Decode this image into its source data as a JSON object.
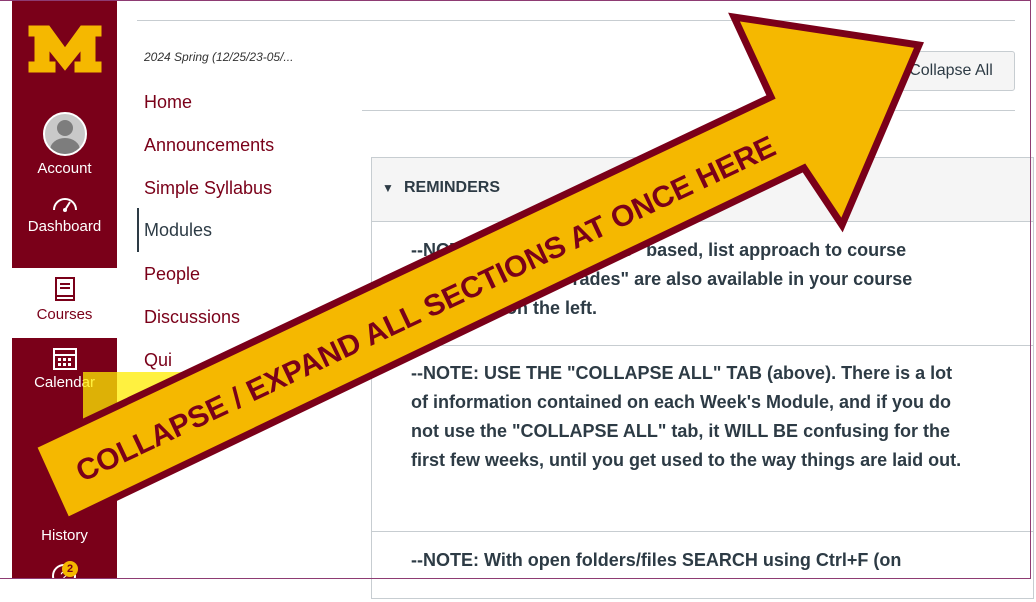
{
  "global_nav": {
    "account": "Account",
    "dashboard": "Dashboard",
    "courses": "Courses",
    "calendar": "Calendar",
    "history": "History",
    "help_badge": "2"
  },
  "course_nav": {
    "term": "2024 Spring (12/25/23-05/...",
    "items": [
      "Home",
      "Announcements",
      "Simple Syllabus",
      "Modules",
      "People",
      "Discussions",
      "Qui"
    ],
    "current": "Modules"
  },
  "toolbar": {
    "collapse_all_label": "Collapse All"
  },
  "module": {
    "title": "REMINDERS",
    "items": [
      "--NOTE: This is a \"Module\" based, list approach to course listings, though \"Grades\" are also available in your course navigation on the left.",
      "--NOTE: USE THE \"COLLAPSE ALL\" TAB (above). There is a lot of information contained on each Week's Module, and if you do not use the \"COLLAPSE ALL\" tab, it WILL BE confusing for the first few weeks, until you get used to the way things are laid out.",
      "--NOTE: With open folders/files SEARCH using Ctrl+F (on"
    ]
  },
  "annotation": {
    "text": "COLLAPSE / EXPAND ALL SECTIONS AT ONCE HERE",
    "arrow_fill": "#f5b800",
    "arrow_stroke": "#7a0019"
  },
  "colors": {
    "maroon": "#7a0019",
    "gold": "#f5b800",
    "text": "#2d3b45"
  }
}
